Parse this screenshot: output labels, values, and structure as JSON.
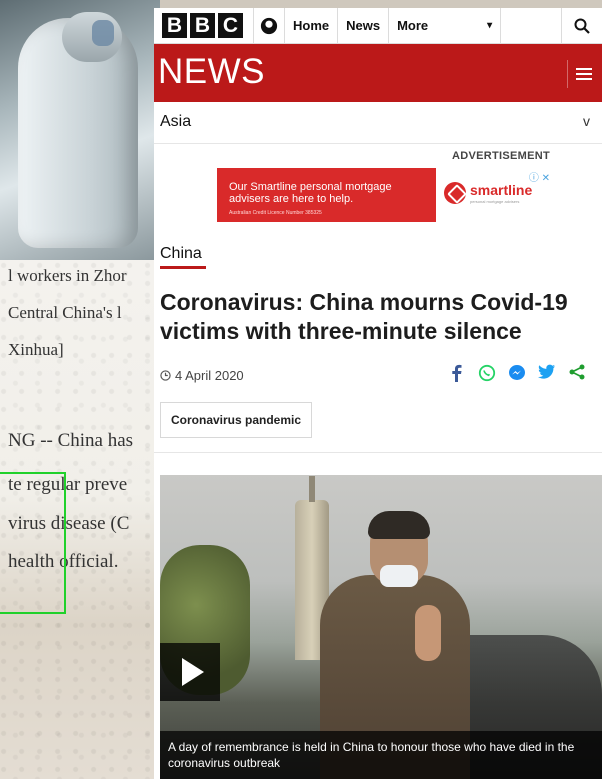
{
  "background": {
    "lines": [
      "l workers in Zhor",
      "Central China's l",
      "Xinhua]",
      "NG -- China has",
      "te regular preve",
      "virus disease (C",
      "health official."
    ]
  },
  "bbc": {
    "logo_letters": [
      "B",
      "B",
      "C"
    ],
    "nav": {
      "home": "Home",
      "news": "News",
      "more": "More",
      "more_icon": "▾"
    },
    "search_icon": "search-icon"
  },
  "news_bar": {
    "title": "NEWS"
  },
  "region": {
    "label": "Asia",
    "chevron": "v"
  },
  "advertisement": {
    "label": "ADVERTISEMENT",
    "text": "Our Smartline personal mortgage advisers are here to help.",
    "fine_print": "Australian Credit Licence Number 385325",
    "brand": "smartline",
    "brand_sub": "personal mortgage advisers",
    "close": "ⓘ ✕",
    "color": "#d92a2a"
  },
  "article": {
    "section": "China",
    "headline": "Coronavirus: China mourns Covid-19 victims with three-minute silence",
    "date": "4 April 2020",
    "tag": "Coronavirus pandemic",
    "image_caption": "A day of remembrance is held in China to honour those who have died in the coronavirus outbreak"
  },
  "share": [
    {
      "name": "facebook",
      "glyph": "f",
      "color": "#3b5998"
    },
    {
      "name": "whatsapp",
      "glyph": "✆",
      "color": "#25d366"
    },
    {
      "name": "messenger",
      "glyph": "✉",
      "color": "#1a8cf0"
    },
    {
      "name": "twitter",
      "glyph": "✦",
      "color": "#1da1f2"
    },
    {
      "name": "share",
      "glyph": "⋖",
      "color": "#1f9d2f"
    }
  ],
  "colors": {
    "bbc_red": "#bb1919",
    "highlight_box": "#20d12b"
  }
}
